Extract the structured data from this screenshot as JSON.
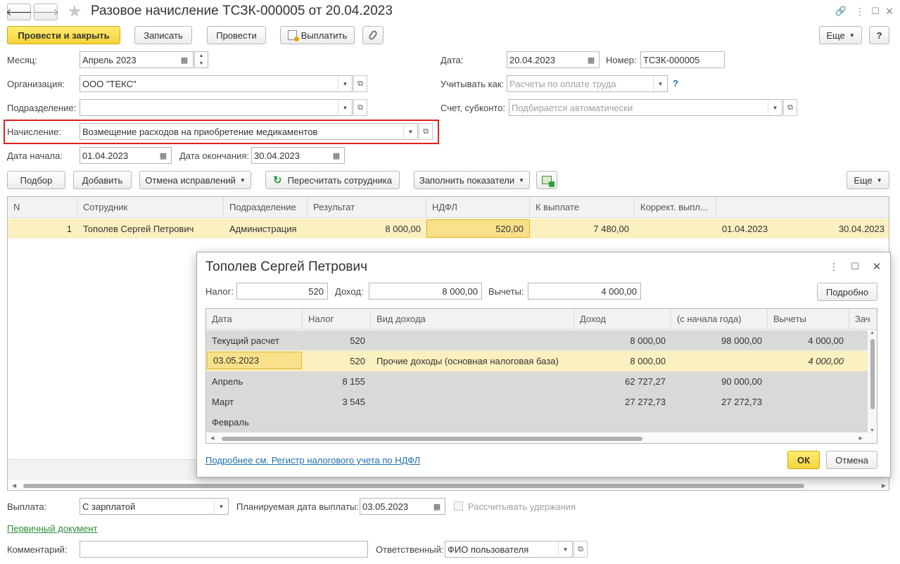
{
  "window": {
    "title": "Разовое начисление ТСЗК-000005 от 20.04.2023",
    "back_glyph": "🡐",
    "forward_glyph": "🡒",
    "star_glyph": "★",
    "link_glyph": "🔗",
    "more_glyph": "⋮",
    "max_glyph": "☐",
    "close_glyph": "✕"
  },
  "toolbar": {
    "post_close": "Провести и закрыть",
    "save": "Записать",
    "post": "Провести",
    "pay": "Выплатить",
    "more": "Еще",
    "help": "?"
  },
  "form": {
    "month_label": "Месяц:",
    "month_value": "Апрель 2023",
    "org_label": "Организация:",
    "org_value": "ООО \"ТЕКС\"",
    "dept_label": "Подразделение:",
    "dept_value": "",
    "accrual_label": "Начисление:",
    "accrual_value": "Возмещение расходов на приобретение медикаментов",
    "start_label": "Дата начала:",
    "start_value": "01.04.2023",
    "end_label": "Дата окончания:",
    "end_value": "30.04.2023",
    "date_label": "Дата:",
    "date_value": "20.04.2023",
    "number_label": "Номер:",
    "number_value": "ТСЗК-000005",
    "account_as_label": "Учитывать как:",
    "account_as_placeholder": "Расчеты по оплате труда",
    "account_as_help": "?",
    "account_label": "Счет, субконто:",
    "account_placeholder": "Подбирается автоматически"
  },
  "table_toolbar": {
    "pick": "Подбор",
    "add": "Добавить",
    "undo_corrections": "Отмена исправлений",
    "recalc": "Пересчитать сотрудника",
    "fill": "Заполнить показатели",
    "more": "Еще"
  },
  "main_table": {
    "headers": [
      "N",
      "Сотрудник",
      "Подразделение",
      "Результат",
      "НДФЛ",
      "К выплате",
      "Коррект. выпл...",
      ""
    ],
    "row": [
      "1",
      "Тополев Сергей Петрович",
      "Администрация",
      "8 000,00",
      "520,00",
      "7 480,00",
      "",
      "01.04.2023",
      "30.04.2023"
    ]
  },
  "bottom": {
    "payment_label": "Выплата:",
    "payment_value": "С зарплатой",
    "planned_date_label": "Планируемая дата выплаты:",
    "planned_date_value": "03.05.2023",
    "calc_deductions_label": "Рассчитывать удержания",
    "primary_doc_link": "Первичный документ",
    "comment_label": "Комментарий:",
    "comment_value": "",
    "responsible_label": "Ответственный:",
    "responsible_value": "ФИО пользователя"
  },
  "dialog": {
    "title": "Тополев Сергей Петрович",
    "tax_label": "Налог:",
    "tax_value": "520",
    "income_label": "Доход:",
    "income_value": "8 000,00",
    "deductions_label": "Вычеты:",
    "deductions_value": "4 000,00",
    "details_button": "Подробно",
    "headers": [
      "Дата",
      "Налог",
      "Вид дохода",
      "Доход",
      "(с начала года)",
      "Вычеты",
      "Зач"
    ],
    "rows": [
      [
        "Текущий расчет",
        "520",
        "",
        "8 000,00",
        "98 000,00",
        "4 000,00"
      ],
      [
        "03.05.2023",
        "520",
        "Прочие доходы (основная налоговая база)",
        "8 000,00",
        "",
        "4 000,00"
      ],
      [
        "Апрель",
        "8 155",
        "",
        "62 727,27",
        "90 000,00",
        ""
      ],
      [
        "Март",
        "3 545",
        "",
        "27 272,73",
        "27 272,73",
        ""
      ],
      [
        "Февраль",
        "",
        "",
        "",
        "",
        ""
      ]
    ],
    "register_link": "Подробнее см. Регистр налогового учета по НДФЛ",
    "ok": "ОК",
    "cancel": "Отмена"
  },
  "colors": {
    "accent_yellow": "#f6d43a",
    "selected_row": "#fbf0c0",
    "selected_cell": "#f9e08a",
    "highlight_border": "#e0201d",
    "link": "#1f6fb0",
    "group_row": "#d9d9d9"
  }
}
